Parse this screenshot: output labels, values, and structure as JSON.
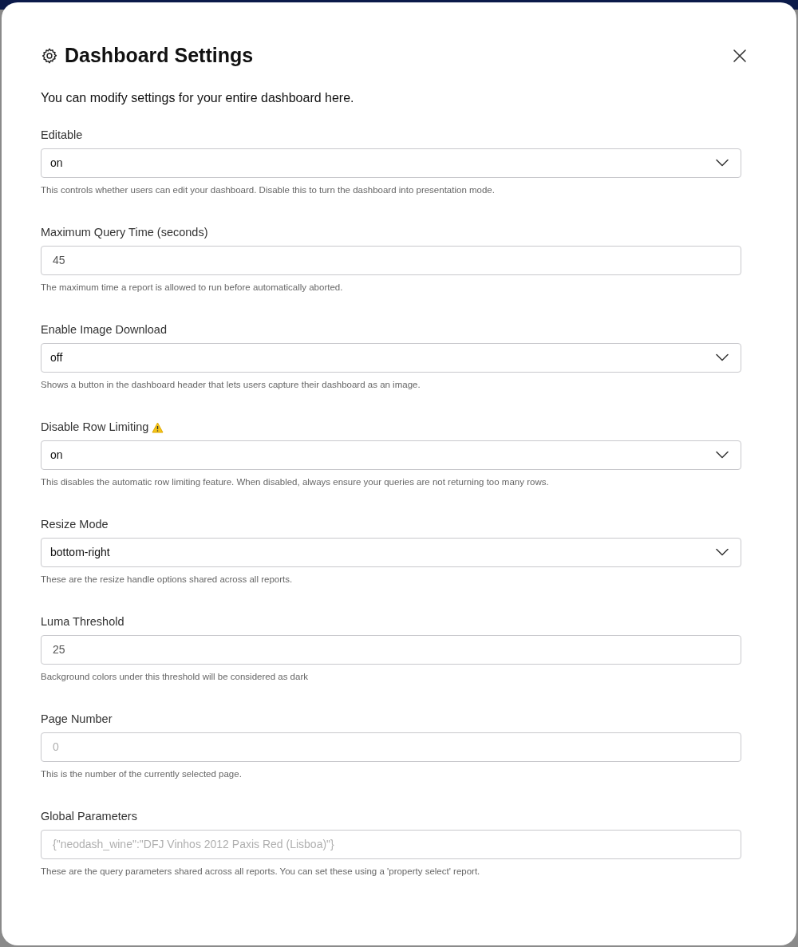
{
  "dialog": {
    "title": "Dashboard Settings",
    "description": "You can modify settings for your entire dashboard here."
  },
  "settings": [
    {
      "label": "Editable",
      "kind": "select",
      "value": "on",
      "help": "This controls whether users can edit your dashboard. Disable this to turn the dashboard into presentation mode."
    },
    {
      "label": "Maximum Query Time (seconds)",
      "kind": "input",
      "value": "45",
      "disabled": false,
      "help": "The maximum time a report is allowed to run before automatically aborted."
    },
    {
      "label": "Enable Image Download",
      "kind": "select",
      "value": "off",
      "help": "Shows a button in the dashboard header that lets users capture their dashboard as an image."
    },
    {
      "label": "Disable Row Limiting",
      "kind": "select",
      "value": "on",
      "warning": true,
      "help": "This disables the automatic row limiting feature. When disabled, always ensure your queries are not returning too many rows."
    },
    {
      "label": "Resize Mode",
      "kind": "select",
      "value": "bottom-right",
      "help": "These are the resize handle options shared across all reports."
    },
    {
      "label": "Luma Threshold",
      "kind": "input",
      "value": "25",
      "disabled": false,
      "help": "Background colors under this threshold will be considered as dark"
    },
    {
      "label": "Page Number",
      "kind": "input",
      "value": "0",
      "disabled": true,
      "help": "This is the number of the currently selected page."
    },
    {
      "label": "Global Parameters",
      "kind": "input",
      "value": "{\"neodash_wine\":\"DFJ Vinhos 2012 Paxis Red (Lisboa)\"}",
      "disabled": true,
      "help": "These are the query parameters shared across all reports. You can set these using a 'property select' report."
    }
  ]
}
